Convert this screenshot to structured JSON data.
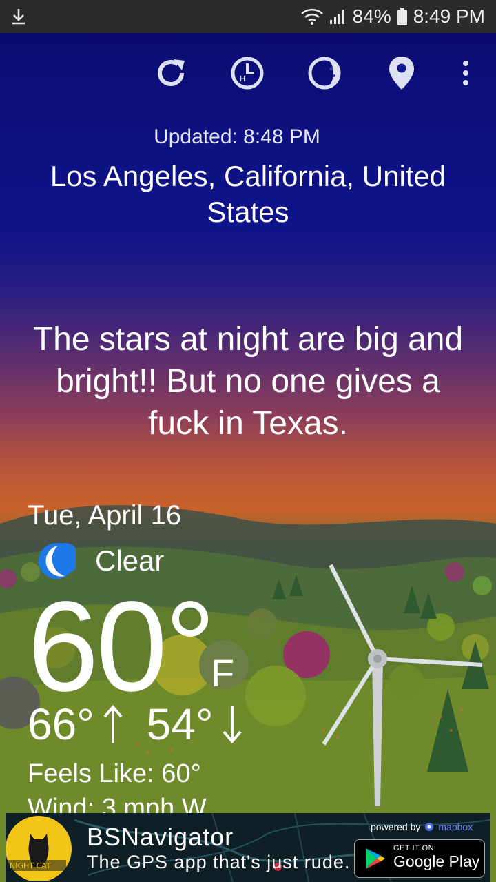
{
  "status_bar": {
    "battery": "84%",
    "time": "8:49 PM"
  },
  "toolbar": {
    "icons": [
      "refresh-icon",
      "hourly-clock-icon",
      "moon-phase-icon",
      "location-pin-icon",
      "more-vert-icon"
    ]
  },
  "weather": {
    "updated": "Updated: 8:48 PM",
    "location": "Los Angeles, California, United States",
    "quote": "The stars at night are big and bright!! But no one gives a fuck in Texas.",
    "date": "Tue, April 16",
    "condition": "Clear",
    "temperature": "60°",
    "unit": "F",
    "high": "66°",
    "low": "54°",
    "feels_like": "Feels Like: 60°",
    "wind": "Wind: 3 mph W"
  },
  "ad": {
    "logo_text": "NIGHT CAT",
    "title": "BSNavigator",
    "tagline": "The GPS app that's just rude.",
    "powered_by": "powered by",
    "mapbox": "mapbox",
    "store_small": "GET IT ON",
    "store_big": "Google Play"
  },
  "colors": {
    "sky_top": "#0a0a66",
    "sky_horizon": "#c9622a",
    "status_bar": "#2b2b2b",
    "moon_icon": "#1e78e6"
  }
}
